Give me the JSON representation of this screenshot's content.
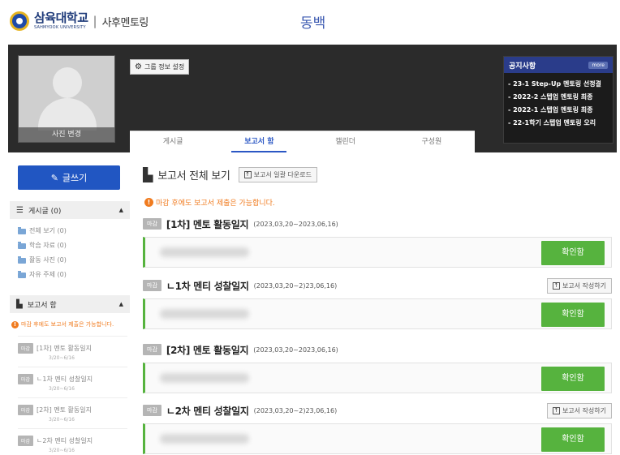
{
  "header": {
    "logo_kr": "삼육대학교",
    "logo_en": "SAHMYOOK UNIVERSITY",
    "separator": "|",
    "sub": "사후멘토링",
    "group_title": "동백"
  },
  "banner": {
    "photo_change": "사진 변경",
    "group_settings": "그룹 정보 설정",
    "tabs": [
      {
        "label": "게시글",
        "active": false
      },
      {
        "label": "보고서 함",
        "active": true
      },
      {
        "label": "캘린더",
        "active": false
      },
      {
        "label": "구성원",
        "active": false
      }
    ]
  },
  "notice": {
    "title": "공지사항",
    "more": "more",
    "items": [
      "- 23-1 Step-Up 멘토링 선정결",
      "- 2022-2 스텝업 멘토링 최종",
      "- 2022-1 스텝업 멘토링 최종",
      "- 22-1학기 스텝업 멘토링 오리"
    ]
  },
  "sidebar": {
    "write_label": "글쓰기",
    "posts_label": "게시글 (0)",
    "folders": [
      "전체 보기 (0)",
      "학습 자료 (0)",
      "활동 사진 (0)",
      "자유 주제 (0)"
    ],
    "reports_label": "보고서 함",
    "warning": "마감 후에도 보고서 제출은 가능합니다.",
    "reports": [
      {
        "badge": "마감",
        "title": "[1차] 멘토 활동일지",
        "date": "3/20~6/16"
      },
      {
        "badge": "마감",
        "title": "ㄴ1차 멘티 성찰일지",
        "date": "3/20~6/16"
      },
      {
        "badge": "마감",
        "title": "[2차] 멘토 활동일지",
        "date": "3/20~6/16"
      },
      {
        "badge": "마감",
        "title": "ㄴ2차 멘티 성찰일지",
        "date": "3/20~6/16"
      }
    ]
  },
  "main": {
    "title": "보고서 전체 보기",
    "bulk_download": "보고서 일괄 다운로드",
    "warning": "마감 후에도 보고서 제출은 가능합니다.",
    "reports": [
      {
        "badge": "마감",
        "title": "[1차] 멘토 활동일지",
        "date": "(2023,03,20~2023,06,16)",
        "write_label": "",
        "confirm": "확인함"
      },
      {
        "badge": "마감",
        "title": "ㄴ1차 멘티 성찰일지",
        "date": "(2023,03,20~2)23,06,16)",
        "write_label": "보고서 작성하기",
        "confirm": "확인함"
      },
      {
        "badge": "마감",
        "title": "[2차] 멘토 활동일지",
        "date": "(2023,03,20~2023,06,16)",
        "write_label": "",
        "confirm": "확인함"
      },
      {
        "badge": "마감",
        "title": "ㄴ2차 멘티 성찰일지",
        "date": "(2023,03,20~2)23,06,16)",
        "write_label": "보고서 작성하기",
        "confirm": "확인함"
      }
    ]
  },
  "colors": {
    "brand_blue": "#2156c2",
    "confirm_green": "#56b33e",
    "warning_orange": "#f07b1f",
    "notice_header": "#2a3c8a"
  }
}
